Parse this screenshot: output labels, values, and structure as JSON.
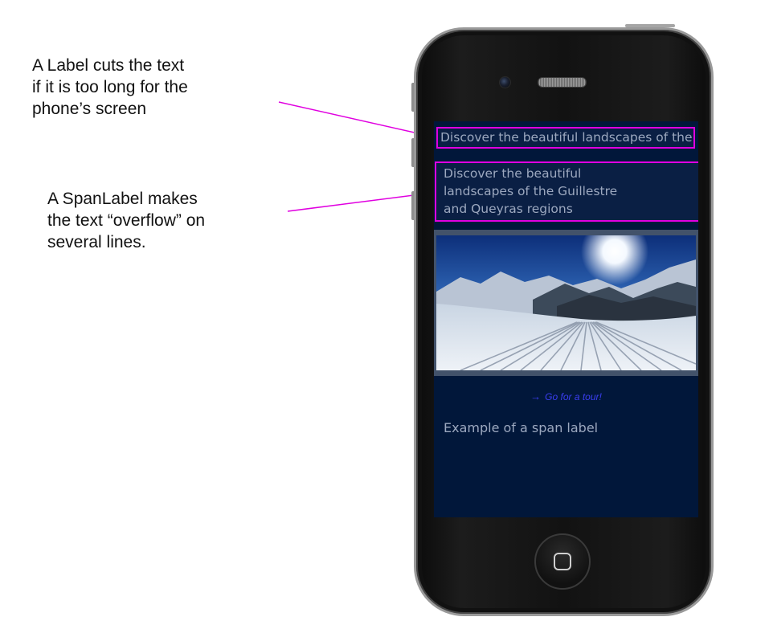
{
  "annotations": {
    "label_note": "A Label cuts the text\nif it is too long for the\nphone’s screen",
    "spanlabel_note": "A SpanLabel makes\nthe text “overflow” on\nseveral lines."
  },
  "app": {
    "label_text": "Discover the beautiful landscapes of the Guillestre and Queyras regions",
    "spanlabel_text": "Discover the beautiful landscapes of the Guillestre and Queyras regions",
    "tour_link": "Go for a tour!",
    "span_label_example": "Example of a span label"
  },
  "colors": {
    "screen_bg": "#01173a",
    "highlight": "#e000e0",
    "link": "#3a3ef0",
    "text": "#9ca8bf"
  },
  "icons": {
    "tour_link_icon": "arrow-right-icon",
    "home_button_icon": "home-square-icon"
  }
}
